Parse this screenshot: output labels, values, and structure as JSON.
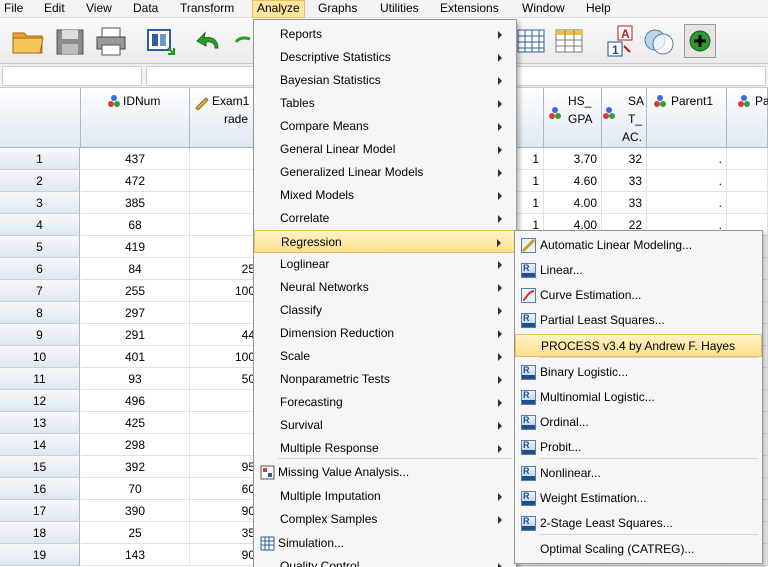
{
  "menubar": [
    "File",
    "Edit",
    "View",
    "Data",
    "Transform",
    "Analyze",
    "Graphs",
    "Utilities",
    "Extensions",
    "Window",
    "Help"
  ],
  "grid": {
    "columns": [
      {
        "name": "IDNum",
        "line2": ""
      },
      {
        "name": "Exam1",
        "line2": "rade"
      },
      {
        "name": "",
        "line2": ""
      },
      {
        "name": "HS_",
        "line2": "GPA"
      },
      {
        "name": "SA",
        "line2": "T_",
        "line3": "AC."
      },
      {
        "name": "Parent1",
        "line2": ""
      },
      {
        "name": "Pa",
        "line2": ""
      }
    ],
    "rows": [
      {
        "n": "1",
        "id": "437",
        "exam": "",
        "c": "1",
        "gpa": "3.70",
        "sat": "32",
        "p1": "."
      },
      {
        "n": "2",
        "id": "472",
        "exam": "",
        "c": "1",
        "gpa": "4.60",
        "sat": "33",
        "p1": "."
      },
      {
        "n": "3",
        "id": "385",
        "exam": "",
        "c": "1",
        "gpa": "4.00",
        "sat": "33",
        "p1": "."
      },
      {
        "n": "4",
        "id": "68",
        "exam": "",
        "c": "1",
        "gpa": "4.00",
        "sat": "22",
        "p1": "."
      },
      {
        "n": "5",
        "id": "419",
        "exam": "",
        "c": "",
        "gpa": "",
        "sat": "",
        "p1": ""
      },
      {
        "n": "6",
        "id": "84",
        "exam": "25",
        "c": "",
        "gpa": "",
        "sat": "",
        "p1": ""
      },
      {
        "n": "7",
        "id": "255",
        "exam": "100",
        "c": "",
        "gpa": "",
        "sat": "",
        "p1": ""
      },
      {
        "n": "8",
        "id": "297",
        "exam": "",
        "c": "",
        "gpa": "",
        "sat": "",
        "p1": ""
      },
      {
        "n": "9",
        "id": "291",
        "exam": "44",
        "c": "",
        "gpa": "",
        "sat": "",
        "p1": ""
      },
      {
        "n": "10",
        "id": "401",
        "exam": "100",
        "c": "",
        "gpa": "",
        "sat": "",
        "p1": ""
      },
      {
        "n": "11",
        "id": "93",
        "exam": "50",
        "c": "",
        "gpa": "",
        "sat": "",
        "p1": ""
      },
      {
        "n": "12",
        "id": "496",
        "exam": "",
        "c": "",
        "gpa": "",
        "sat": "",
        "p1": ""
      },
      {
        "n": "13",
        "id": "425",
        "exam": "",
        "c": "",
        "gpa": "",
        "sat": "",
        "p1": ""
      },
      {
        "n": "14",
        "id": "298",
        "exam": "",
        "c": "",
        "gpa": "",
        "sat": "",
        "p1": ""
      },
      {
        "n": "15",
        "id": "392",
        "exam": "95",
        "c": "",
        "gpa": "",
        "sat": "",
        "p1": ""
      },
      {
        "n": "16",
        "id": "70",
        "exam": "60",
        "c": "",
        "gpa": "",
        "sat": "",
        "p1": ""
      },
      {
        "n": "17",
        "id": "390",
        "exam": "90",
        "c": "",
        "gpa": "",
        "sat": "",
        "p1": ""
      },
      {
        "n": "18",
        "id": "25",
        "exam": "35",
        "c": "",
        "gpa": "",
        "sat": "",
        "p1": ""
      },
      {
        "n": "19",
        "id": "143",
        "exam": "90",
        "c": "",
        "gpa": "",
        "sat": "",
        "p1": ""
      }
    ]
  },
  "analyze_menu": [
    {
      "label": "Reports",
      "arrow": true
    },
    {
      "label": "Descriptive Statistics",
      "arrow": true
    },
    {
      "label": "Bayesian Statistics",
      "arrow": true
    },
    {
      "label": "Tables",
      "arrow": true
    },
    {
      "label": "Compare Means",
      "arrow": true
    },
    {
      "label": "General Linear Model",
      "arrow": true
    },
    {
      "label": "Generalized Linear Models",
      "arrow": true
    },
    {
      "label": "Mixed Models",
      "arrow": true
    },
    {
      "label": "Correlate",
      "arrow": true
    },
    {
      "label": "Regression",
      "arrow": true
    },
    {
      "label": "Loglinear",
      "arrow": true
    },
    {
      "label": "Neural Networks",
      "arrow": true
    },
    {
      "label": "Classify",
      "arrow": true
    },
    {
      "label": "Dimension Reduction",
      "arrow": true
    },
    {
      "label": "Scale",
      "arrow": true
    },
    {
      "label": "Nonparametric Tests",
      "arrow": true
    },
    {
      "label": "Forecasting",
      "arrow": true
    },
    {
      "label": "Survival",
      "arrow": true
    },
    {
      "label": "Multiple Response",
      "arrow": true
    },
    {
      "label": "Missing Value Analysis...",
      "arrow": false
    },
    {
      "label": "Multiple Imputation",
      "arrow": true
    },
    {
      "label": "Complex Samples",
      "arrow": true
    },
    {
      "label": "Simulation...",
      "arrow": false
    },
    {
      "label": "Quality Control",
      "arrow": true
    }
  ],
  "regression_menu": [
    {
      "label": "Automatic Linear Modeling...",
      "code": "ALM"
    },
    {
      "label": "Linear...",
      "code": "LIN"
    },
    {
      "label": "Curve Estimation...",
      "code": "CRV"
    },
    {
      "label": "Partial Least Squares...",
      "code": "PLS"
    },
    {
      "label": "PROCESS v3.4 by Andrew F. Hayes",
      "code": ""
    },
    {
      "label": "Binary Logistic...",
      "code": "LOG"
    },
    {
      "label": "Multinomial Logistic...",
      "code": "MLT"
    },
    {
      "label": "Ordinal...",
      "code": "ORD"
    },
    {
      "label": "Probit...",
      "code": "PRB"
    },
    {
      "label": "Nonlinear...",
      "code": "NLR"
    },
    {
      "label": "Weight Estimation...",
      "code": "WLS"
    },
    {
      "label": "2-Stage Least Squares...",
      "code": "2SL"
    },
    {
      "label": "Optimal Scaling (CATREG)...",
      "code": ""
    }
  ],
  "colors": {
    "highlight": "#fcdf8a",
    "header": "#dfe7f1"
  }
}
